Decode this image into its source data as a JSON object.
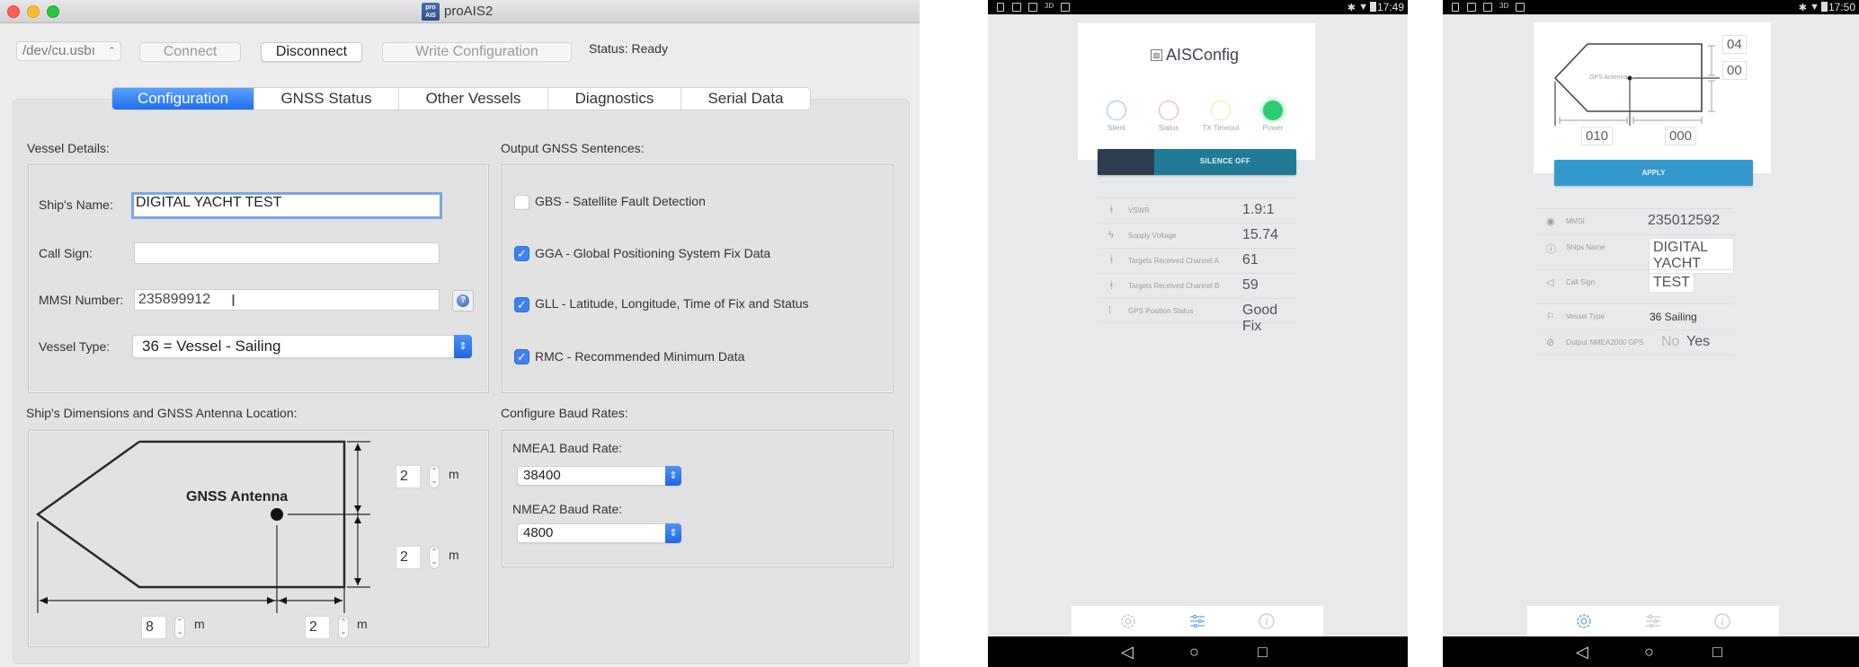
{
  "mac_window": {
    "title": "proAIS2",
    "app_icon_label": "pro AIS",
    "toolbar": {
      "port_select": "/dev/cu.usbı",
      "connect_label": "Connect",
      "disconnect_label": "Disconnect",
      "write_config_label": "Write Configuration",
      "status_text": "Status: Ready"
    },
    "tabs": [
      {
        "label": "Configuration",
        "selected": true
      },
      {
        "label": "GNSS Status",
        "selected": false
      },
      {
        "label": "Other Vessels",
        "selected": false
      },
      {
        "label": "Diagnostics",
        "selected": false
      },
      {
        "label": "Serial Data",
        "selected": false
      }
    ],
    "vessel_details": {
      "section_label": "Vessel Details:",
      "ship_name_label": "Ship's Name:",
      "ship_name_value": "DIGITAL YACHT TEST",
      "call_sign_label": "Call Sign:",
      "call_sign_value": "",
      "mmsi_label": "MMSI Number:",
      "mmsi_value": "235899912",
      "help_icon": "?",
      "vessel_type_label": "Vessel Type:",
      "vessel_type_value": "36 = Vessel - Sailing"
    },
    "gnss_sentences": {
      "section_label": "Output GNSS Sentences:",
      "items": [
        {
          "label": "GBS - Satellite Fault Detection",
          "checked": false
        },
        {
          "label": "GGA - Global Positioning System Fix Data",
          "checked": true
        },
        {
          "label": "GLL - Latitude, Longitude, Time of Fix and Status",
          "checked": true
        },
        {
          "label": "RMC - Recommended Minimum Data",
          "checked": true
        }
      ]
    },
    "dimensions": {
      "section_label": "Ship's Dimensions and GNSS Antenna Location:",
      "antenna_label": "GNSS Antenna",
      "to_port": "2",
      "to_starboard": "2",
      "to_bow": "8",
      "to_stern": "2",
      "unit": "m"
    },
    "baud_rates": {
      "section_label": "Configure Baud Rates:",
      "nmea1_label": "NMEA1 Baud Rate:",
      "nmea1_value": "38400",
      "nmea2_label": "NMEA2 Baud Rate:",
      "nmea2_value": "4800"
    }
  },
  "phone_status": {
    "time": "17:49",
    "app_title": "AISConfig",
    "leds": [
      {
        "label": "Silent",
        "color": "#8ec3f0",
        "on": false
      },
      {
        "label": "Status",
        "color": "#f3a6a6",
        "on": false
      },
      {
        "label": "TX Timeout",
        "color": "#f5e98a",
        "on": false
      },
      {
        "label": "Power",
        "color": "#2ecc71",
        "on": true
      }
    ],
    "silence_button_label": "SILENCE OFF",
    "rows": [
      {
        "icon": "antenna-icon",
        "label": "VSWR",
        "value": "1.9:1"
      },
      {
        "icon": "bolt-icon",
        "label": "Supply Voltage",
        "value": "15.74"
      },
      {
        "icon": "antenna-icon",
        "label": "Targets Received Channel A",
        "value": "61"
      },
      {
        "icon": "antenna-icon",
        "label": "Targets Received Channel B",
        "value": "59"
      },
      {
        "icon": "gps-icon",
        "label": "GPS Position Status",
        "value": "Good Fix"
      }
    ],
    "active_tab": "settings-sliders"
  },
  "phone_config": {
    "time": "17:50",
    "antenna_label": "GPS Antenna",
    "to_port": "04",
    "to_starboard": "00",
    "to_bow": "010",
    "to_stern": "000",
    "apply_label": "APPLY",
    "rows": [
      {
        "icon": "eye-icon",
        "label": "MMSI",
        "value": "235012592"
      },
      {
        "icon": "info-icon",
        "label": "Ships Name",
        "value": "DIGITAL YACHT"
      },
      {
        "icon": "megaphone-icon",
        "label": "Call Sign",
        "value": "TEST"
      },
      {
        "icon": "flag-icon",
        "label": "Vessel Type",
        "value": "36 Sailing"
      },
      {
        "icon": "compass-icon",
        "label": "Output NMEA2000 GPS",
        "value_no": "No",
        "value_yes": "Yes"
      }
    ],
    "active_tab": "gear"
  },
  "nav": {
    "back": "◁",
    "home": "○",
    "recents": "□"
  },
  "colors": {
    "accent_blue": "#1e6ff0",
    "teal": "#217a96",
    "apply_blue": "#3399cc",
    "power_green": "#2ecc71"
  }
}
